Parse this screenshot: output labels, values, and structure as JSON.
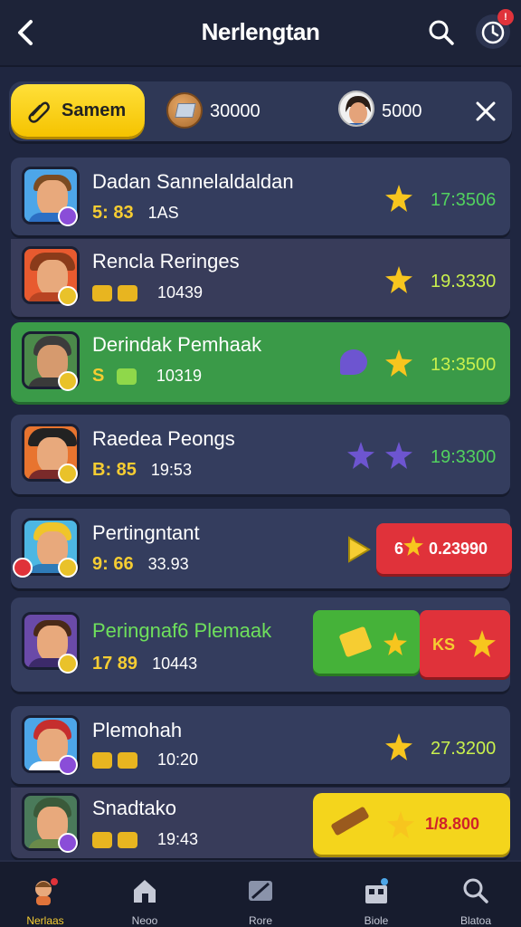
{
  "header": {
    "title": "Nerlengtan",
    "notification_count": "!"
  },
  "resources": {
    "button_label": "Samem",
    "coins": "30000",
    "gems": "5000"
  },
  "rows": [
    {
      "name": "Dadan Sannelaldaldan",
      "level": "5: 83",
      "mid": "1AS",
      "score": "17:3506",
      "stars": 1
    },
    {
      "name": "Rencla Reringes",
      "level": "",
      "mid": "10439",
      "score": "19.3330",
      "stars": 1
    },
    {
      "name": "Derindak Pemhaak",
      "level": "S",
      "mid": "10319",
      "score": "13:3500",
      "stars": 1
    },
    {
      "name": "Raedea Peongs",
      "level": "B: 85",
      "mid": "19:53",
      "score": "19:3300",
      "stars": 2
    },
    {
      "name": "Pertingntant",
      "level": "9: 66",
      "mid": "33.93",
      "score": "0.23990",
      "pill_prefix": "6",
      "stars": 0
    },
    {
      "name": "Peringnaf6 Plemaak",
      "level": "17 89",
      "mid": "10443",
      "score": "KS",
      "stars": 2
    },
    {
      "name": "Plemohah",
      "level": "",
      "mid": "10:20",
      "score": "27.3200",
      "stars": 1
    },
    {
      "name": "Snadtako",
      "level": "",
      "mid": "19:43",
      "score": "1/8.800",
      "stars": 1
    }
  ],
  "nav": {
    "items": [
      {
        "label": "Nerlaas",
        "active": true
      },
      {
        "label": "Neoo",
        "active": false
      },
      {
        "label": "Rore",
        "active": false
      },
      {
        "label": "Biole",
        "active": false
      },
      {
        "label": "Blatoa",
        "active": false
      }
    ]
  },
  "colors": {
    "background": "#1f2640",
    "accent_yellow": "#f6cd32",
    "score_green": "#52d15f",
    "row_green": "#3a9a48",
    "pill_red": "#e0323a"
  }
}
